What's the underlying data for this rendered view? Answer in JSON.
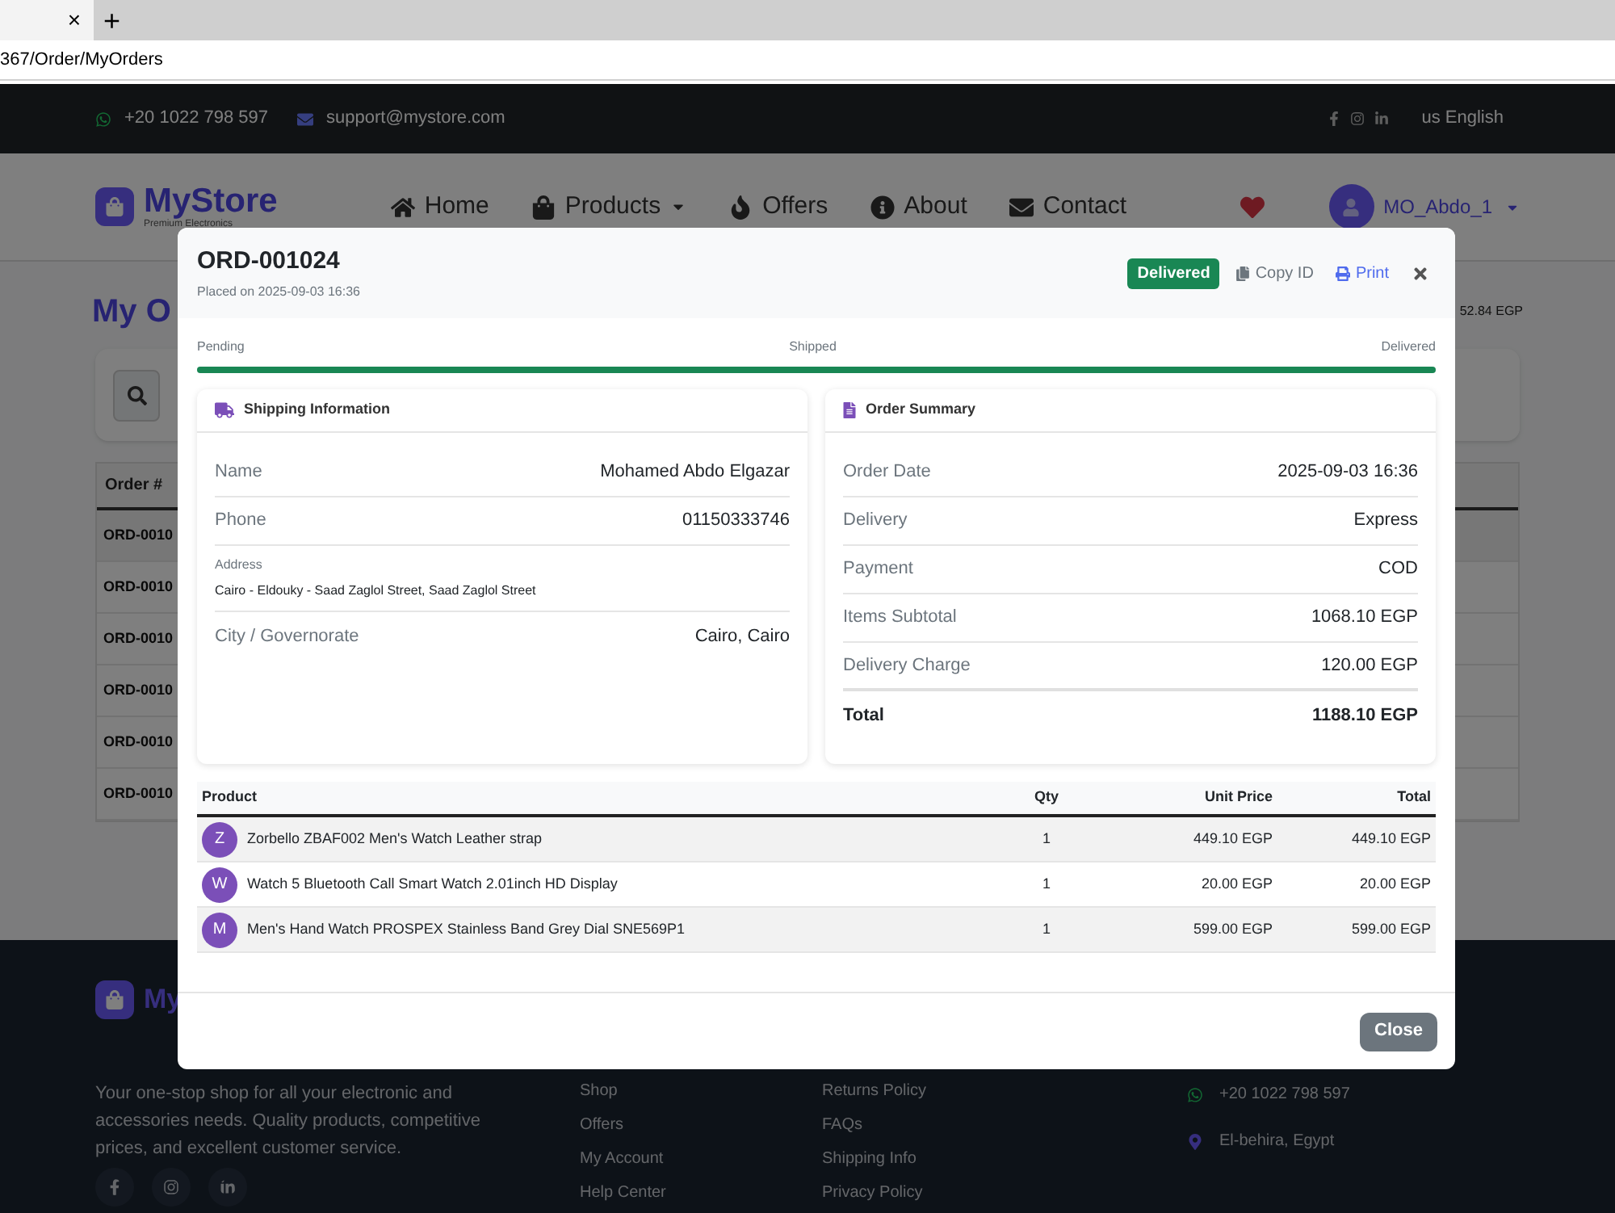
{
  "browser": {
    "tab_close": "×",
    "new_tab": "+",
    "address": "367/Order/MyOrders"
  },
  "topbar": {
    "phone": "+20 1022 798 597",
    "email": "support@mystore.com",
    "language": "us English"
  },
  "navbar": {
    "brand": "MyStore",
    "tagline": "Premium Electronics",
    "links": [
      {
        "label": "Home",
        "dropdown": false
      },
      {
        "label": "Products",
        "dropdown": true
      },
      {
        "label": "Offers",
        "dropdown": false
      },
      {
        "label": "About",
        "dropdown": false
      },
      {
        "label": "Contact",
        "dropdown": false
      }
    ],
    "user": "MO_Abdo_1"
  },
  "page": {
    "title": "My O",
    "balance": "52.84 EGP",
    "table": {
      "columns": [
        "Order #"
      ],
      "rows": [
        "ORD-0010",
        "ORD-0010",
        "ORD-0010",
        "ORD-0010",
        "ORD-0010",
        "ORD-0010"
      ]
    }
  },
  "modal": {
    "title": "ORD-001024",
    "subtitle": "Placed on 2025-09-03 16:36",
    "status": "Delivered",
    "copy_label": "Copy ID",
    "print_label": "Print",
    "progress": {
      "steps": [
        "Pending",
        "Shipped",
        "Delivered"
      ],
      "level": 1
    },
    "shipping": {
      "title": "Shipping Information",
      "rows": [
        {
          "kind": "inline",
          "label": "Name",
          "value": "Mohamed Abdo Elgazar"
        },
        {
          "kind": "inline",
          "label": "Phone",
          "value": "01150333746"
        },
        {
          "kind": "stacked",
          "label": "Address",
          "value": "Cairo - Eldouky - Saad Zaglol Street, Saad Zaglol Street"
        },
        {
          "kind": "inline",
          "label": "City / Governorate",
          "value": "Cairo, Cairo"
        }
      ]
    },
    "summary": {
      "title": "Order Summary",
      "rows": [
        {
          "kind": "normal",
          "label": "Order Date",
          "value": "2025-09-03 16:36"
        },
        {
          "kind": "normal",
          "label": "Delivery",
          "value": "Express"
        },
        {
          "kind": "normal",
          "label": "Payment",
          "value": "COD"
        },
        {
          "kind": "normal",
          "label": "Items Subtotal",
          "value": "1068.10 EGP"
        },
        {
          "kind": "normal",
          "label": "Delivery Charge",
          "value": "120.00 EGP"
        },
        {
          "kind": "total",
          "label": "Total",
          "value": "1188.10 EGP"
        }
      ]
    },
    "items": {
      "columns": [
        "Product",
        "Qty",
        "Unit Price",
        "Total"
      ],
      "rows": [
        {
          "initial": "Z",
          "product": "Zorbello ZBAF002 Men's Watch Leather strap",
          "qty": "1",
          "unit_price": "449.10 EGP",
          "total": "449.10 EGP"
        },
        {
          "initial": "W",
          "product": "Watch 5 Bluetooth Call Smart Watch 2.01inch HD Display",
          "qty": "1",
          "unit_price": "20.00 EGP",
          "total": "20.00 EGP"
        },
        {
          "initial": "M",
          "product": "Men's Hand Watch PROSPEX Stainless Band Grey Dial SNE569P1",
          "qty": "1",
          "unit_price": "599.00 EGP",
          "total": "599.00 EGP"
        }
      ]
    },
    "close_label": "Close"
  },
  "footer": {
    "brand": "My",
    "about": "Your one-stop shop for all your electronic and accessories needs. Quality products, competitive prices, and excellent customer service.",
    "links_1": [
      "Shop",
      "Offers",
      "My Account",
      "Help Center"
    ],
    "links_2": [
      "Returns Policy",
      "FAQs",
      "Shipping Info",
      "Privacy Policy"
    ],
    "contact": {
      "phone": "+20 1022 798 597",
      "address": "El-behira, Egypt"
    }
  }
}
